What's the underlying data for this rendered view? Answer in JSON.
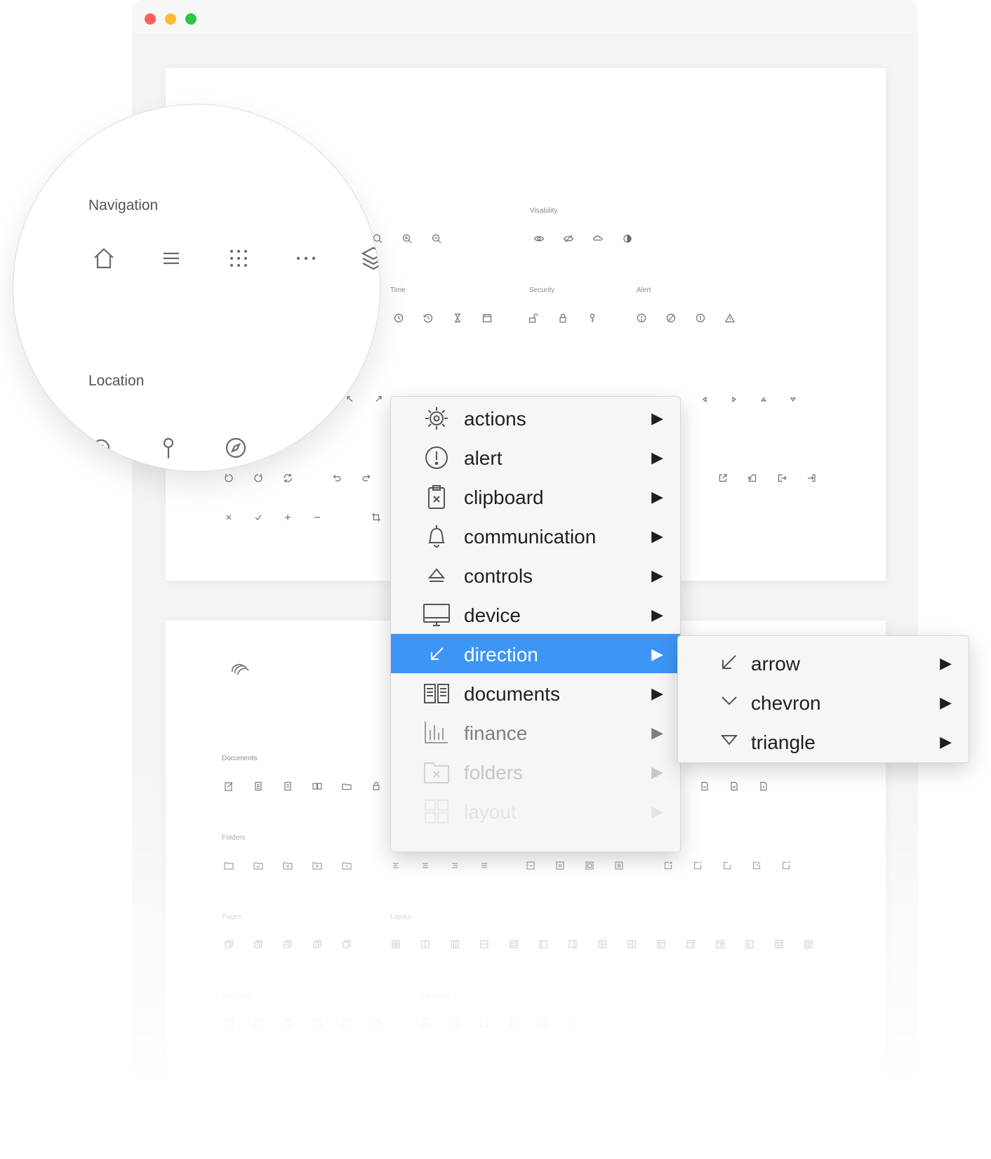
{
  "window": {
    "controls": [
      "close",
      "minimize",
      "zoom"
    ]
  },
  "sheet": {
    "labels": {
      "visability": "Visability",
      "time": "Time",
      "security": "Security",
      "alert": "Alert",
      "documents": "Documents",
      "folders": "Folders",
      "pages": "Pages",
      "layout": "Layout",
      "webpage": "Webpage",
      "clipboard": "Clipboard"
    },
    "icons": {
      "time": [
        "clock-icon",
        "history-icon",
        "hourglass-icon",
        "calendar-icon"
      ],
      "security": [
        "unlock-icon",
        "lock-icon",
        "key-icon"
      ],
      "alert": [
        "alert-circle-icon",
        "block-icon",
        "info-icon",
        "warning-icon"
      ],
      "visability": [
        "eye-icon",
        "eye-off-icon",
        "cloud-icon",
        "contrast-icon"
      ]
    }
  },
  "magnifier": {
    "navigation_title": "Navigation",
    "location_title": "Location",
    "navigation_icons": [
      "home-icon",
      "menu-icon",
      "grid-icon",
      "more-icon",
      "layers-icon"
    ],
    "location_icons": [
      "target-icon",
      "pin-icon",
      "compass-icon"
    ]
  },
  "menu": {
    "items": [
      {
        "label": "actions",
        "icon": "gear-icon",
        "arrow": "▶"
      },
      {
        "label": "alert",
        "icon": "alert-circle-icon",
        "arrow": "▶"
      },
      {
        "label": "clipboard",
        "icon": "clipboard-icon",
        "arrow": "▶"
      },
      {
        "label": "communication",
        "icon": "bell-icon",
        "arrow": "▶"
      },
      {
        "label": "controls",
        "icon": "eject-icon",
        "arrow": "▶"
      },
      {
        "label": "device",
        "icon": "monitor-icon",
        "arrow": "▶"
      },
      {
        "label": "direction",
        "icon": "arrow-down-left-icon",
        "arrow": "▶",
        "active": true
      },
      {
        "label": "documents",
        "icon": "book-icon",
        "arrow": "▶"
      },
      {
        "label": "finance",
        "icon": "bar-chart-icon",
        "arrow": "▶"
      },
      {
        "label": "folders",
        "icon": "folder-icon",
        "arrow": "▶"
      },
      {
        "label": "layout",
        "icon": "layout-icon",
        "arrow": "▶"
      }
    ],
    "submenu": [
      {
        "label": "arrow",
        "icon": "arrow-down-left-icon",
        "arrow": "▶"
      },
      {
        "label": "chevron",
        "icon": "chevron-down-icon",
        "arrow": "▶"
      },
      {
        "label": "triangle",
        "icon": "triangle-down-icon",
        "arrow": "▶"
      }
    ]
  },
  "colors": {
    "accent": "#3d95f5",
    "close": "#fe5f57",
    "minimize": "#febc2e",
    "zoom": "#28c840"
  }
}
